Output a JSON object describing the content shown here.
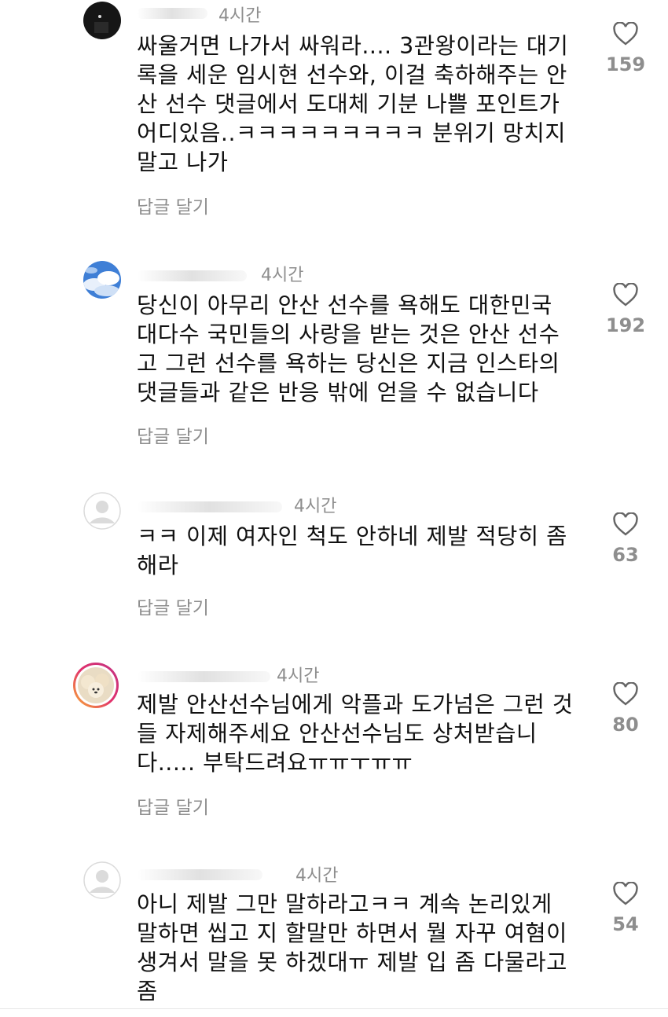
{
  "comments": [
    {
      "time": "4시간",
      "text": "싸울거면 나가서 싸워라.... 3관왕이라는 대기\n록을 세운 임시현 선수와, 이걸 축하해주는 안\n산 선수 댓글에서 도대체 기분 나쁠 포인트가\n어디있음..ㅋㅋㅋㅋㅋㅋㅋㅋㅋ 분위기 망치지\n말고 나가",
      "reply": "답글 달기",
      "likes": "159"
    },
    {
      "time": "4시간",
      "text": "당신이 아무리 안산 선수를 욕해도 대한민국\n대다수 국민들의 사랑을 받는 것은 안산 선수\n고 그런 선수를 욕하는 당신은 지금 인스타의\n댓글들과 같은 반응 밖에 얻을 수 없습니다",
      "reply": "답글 달기",
      "likes": "192"
    },
    {
      "time": "4시간",
      "text": "ㅋㅋ 이제 여자인 척도 안하네 제발 적당히 좀\n해라",
      "reply": "답글 달기",
      "likes": "63"
    },
    {
      "time": "4시간",
      "text": "제발 안산선수님에게 악플과 도가넘은 그런 것\n들 자제해주세요 안산선수님도 상처받습니\n다..... 부탁드려요ㅠㅠㅜㅠㅠ",
      "reply": "답글 달기",
      "likes": "80"
    },
    {
      "time": "4시간",
      "text": "아니 제발 그만 말하라고ㅋㅋ 계속 논리있게\n말하면 씹고 지 할말만 하면서 뭘 자꾸 여혐이\n생겨서 말을 못 하겠대ㅠ 제발 입 좀 다물라고\n좀",
      "reply": "",
      "likes": "54"
    }
  ],
  "icons": {
    "like": "heart-outline-icon"
  },
  "colors": {
    "muted": "#8e8e8e",
    "text": "#111111"
  }
}
